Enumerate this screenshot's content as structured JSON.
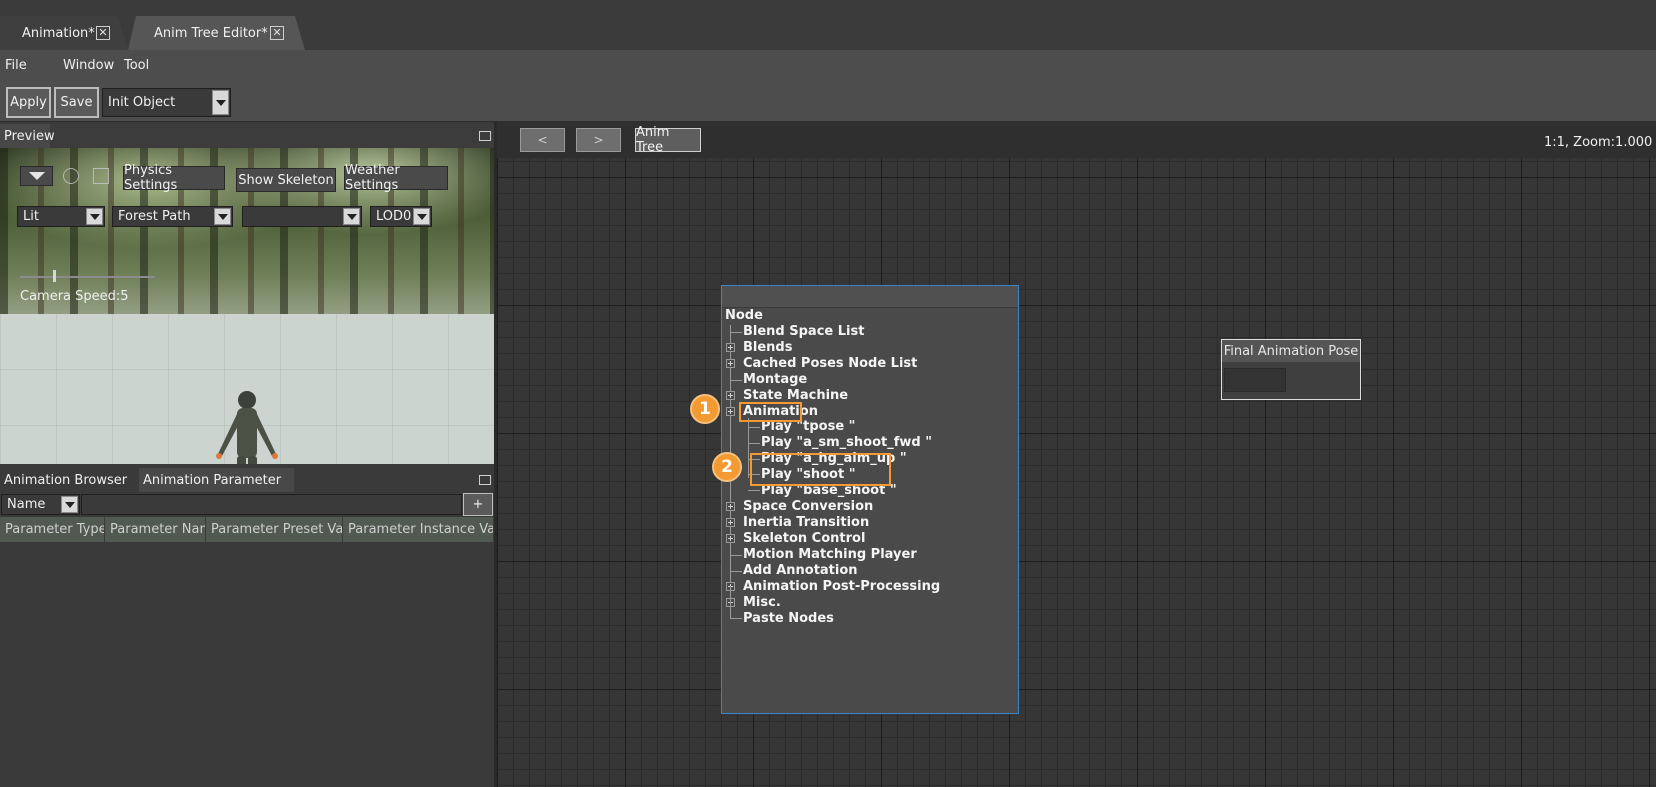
{
  "tabs": [
    {
      "label": "Animation*",
      "active": false
    },
    {
      "label": "Anim Tree Editor*",
      "active": true
    }
  ],
  "close_glyph": "✕",
  "menu": [
    "File",
    "Window",
    "Tool"
  ],
  "toolbar": {
    "apply_label": "Apply",
    "save_label": "Save",
    "object_select_value": "Init Object"
  },
  "preview": {
    "title": "Preview",
    "physics_settings_label": "Physics Settings",
    "show_skeleton_label": "Show Skeleton",
    "weather_settings_label": "Weather Settings",
    "shading_value": "Lit",
    "environment_value": "Forest Path",
    "empty_select_value": "",
    "lod_value": "LOD0",
    "camera_speed_label": "Camera Speed:5"
  },
  "bottom_panel": {
    "tab_browser": "Animation Browser",
    "tab_parameter": "Animation Parameter",
    "filter_value": "Name",
    "add_label": "+",
    "columns": [
      "Parameter Type",
      "Parameter Name",
      "Parameter Preset Value",
      "Parameter Instance Value"
    ]
  },
  "graph": {
    "back_label": "<",
    "forward_label": ">",
    "breadcrumb_label": "Anim Tree",
    "zoom_readout": "1:1, Zoom:1.000"
  },
  "context_menu": {
    "root": "Node",
    "items": [
      "Blend Space List",
      "Blends",
      "Cached Poses Node List",
      "Montage",
      "State Machine",
      "Animation",
      "Play \"tpose \"",
      "Play \"a_sm_shoot_fwd \"",
      "Play \"a_hg_aim_up \"",
      "Play \"shoot \"",
      "Play \"base_shoot \"",
      "Space Conversion",
      "Inertia Transition",
      "Skeleton Control",
      "Motion Matching Player",
      "Add Annotation",
      "Animation Post-Processing",
      "Misc.",
      "Paste Nodes"
    ],
    "badges": [
      "1",
      "2"
    ]
  },
  "final_node": {
    "title": "Final Animation Pose"
  },
  "colors": {
    "accent_highlight": "#f39a33",
    "menu_border": "#3a86c9"
  }
}
